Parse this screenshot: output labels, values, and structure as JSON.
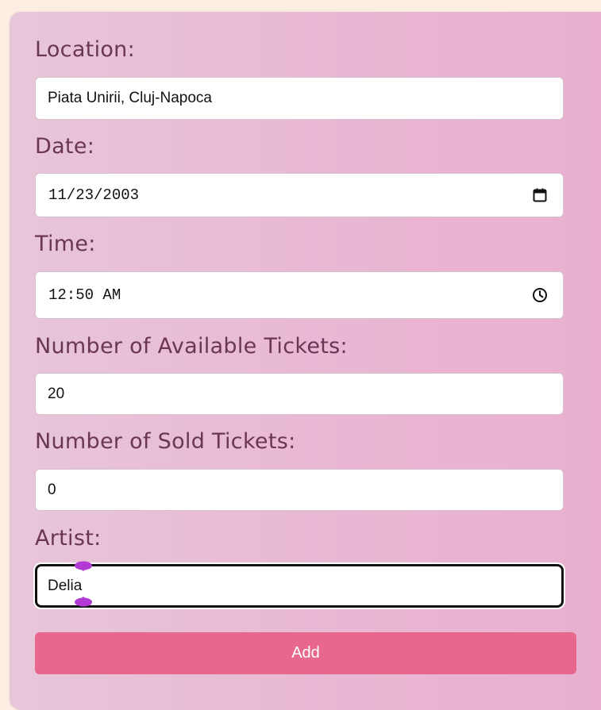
{
  "form": {
    "location": {
      "label": "Location:",
      "value": "Piata Unirii, Cluj-Napoca"
    },
    "date": {
      "label": "Date:",
      "value": "11/23/2003",
      "icon": "calendar-icon"
    },
    "time": {
      "label": "Time:",
      "value": "12:50 AM",
      "icon": "clock-icon"
    },
    "available_tickets": {
      "label": "Number of Available Tickets:",
      "value": "20"
    },
    "sold_tickets": {
      "label": "Number of Sold Tickets:",
      "value": "0"
    },
    "artist": {
      "label": "Artist:",
      "value": "Delia"
    },
    "add_label": "Add"
  },
  "colors": {
    "label": "#6b3653",
    "button": "#e8688d",
    "selection_handle": "#b23ad4"
  }
}
